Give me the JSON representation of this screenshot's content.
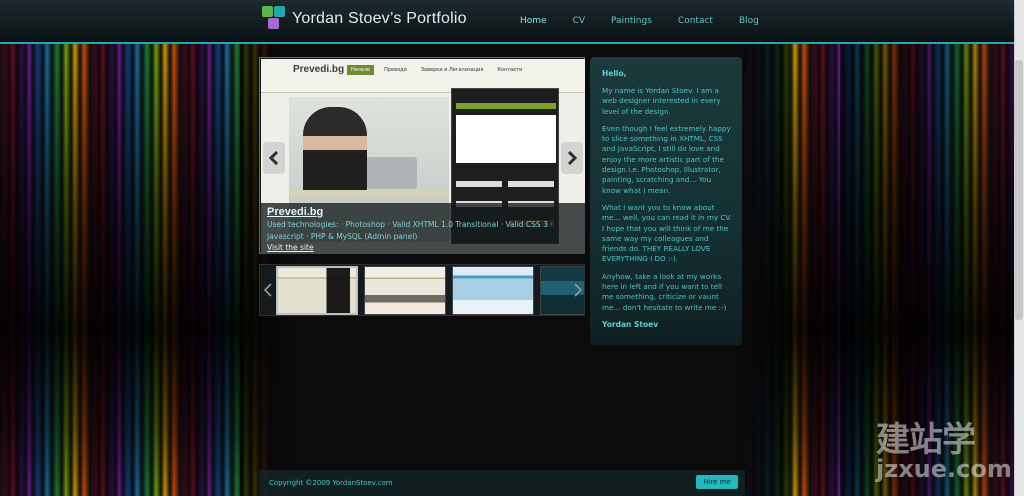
{
  "header": {
    "site_title": "Yordan Stoev’s Portfolio",
    "nav": [
      {
        "label": "Home"
      },
      {
        "label": "CV"
      },
      {
        "label": "Paintings"
      },
      {
        "label": "Contact"
      },
      {
        "label": "Blog"
      }
    ]
  },
  "slider": {
    "caption_title": "Prevedi.bg",
    "technologies": "Used technologies: · Photoshop · Valid XHTML 1.0 Transitional · Valid CSS 3 · Javascript · PHP & MySQL (Admin panel)",
    "visit_link": "Visit the site",
    "screenshot": {
      "logo_text": "Prevedi.bg",
      "menu": [
        "Начало",
        "Преводи",
        "Заверки и Легализация",
        "Контакти"
      ]
    }
  },
  "panel": {
    "greeting": "Hello,",
    "paragraphs": [
      "My name is Yordan Stoev. I am a web designer interested in every level of the design.",
      "Even though I feel extremely happy to slice something in XHTML, CSS and JavaScript, I still do love and enjoy the more artistic part of the design i.e. Photoshop, Illustrator, painting, scratching and… You know what I mean.",
      "What I want you to know about me… well, you can read it in my CV. I hope that you will think of me the same way my colleagues and friends do. THEY REALLY LOVE EVERYTHING I DO :-).",
      "Anyhow, take a look at my works here in left and if you want to tell me something, criticize or vaunt me… don't hesitate to write me :-)"
    ],
    "signature": "Yordan Stoev"
  },
  "footer": {
    "copyright": "Copyright ©2009 YordanStoev.com",
    "hire_button": "Hire me"
  },
  "watermark": {
    "line1": "建站学",
    "line2": "jzxue.com"
  },
  "colors": {
    "accent": "#2aa6ad",
    "panel_text": "#4fc3c9",
    "hire_bg": "#27b8bf"
  }
}
